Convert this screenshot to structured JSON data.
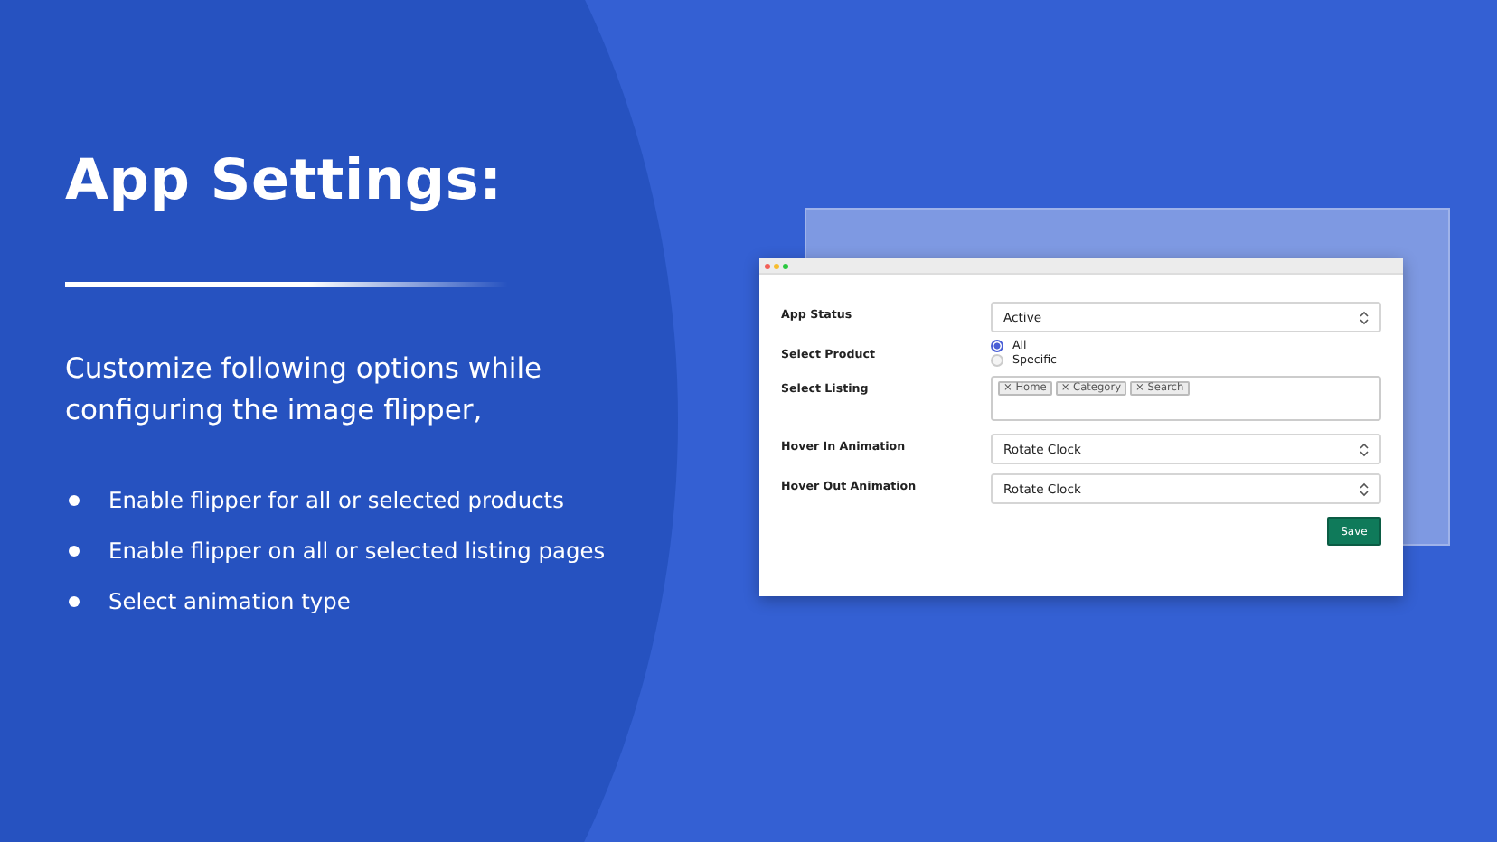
{
  "heading": "App Settings:",
  "description": "Customize following options while configuring the image flipper,",
  "bullets": [
    "Enable flipper for all or selected products",
    "Enable flipper on all or selected listing pages",
    "Select animation type"
  ],
  "form": {
    "fields": [
      {
        "kind": "select",
        "label": "App Status",
        "value": "Active"
      },
      {
        "kind": "radio",
        "label": "Select Product",
        "options": [
          {
            "label": "All",
            "selected": true
          },
          {
            "label": "Specific",
            "selected": false
          }
        ]
      },
      {
        "kind": "tags",
        "label": "Select Listing",
        "tags": [
          "× Home",
          "× Category",
          "× Search"
        ]
      },
      {
        "kind": "select",
        "label": "Hover In Animation",
        "value": "Rotate Clock"
      },
      {
        "kind": "select",
        "label": "Hover Out Animation",
        "value": "Rotate Clock"
      }
    ],
    "save_button": "Save"
  }
}
